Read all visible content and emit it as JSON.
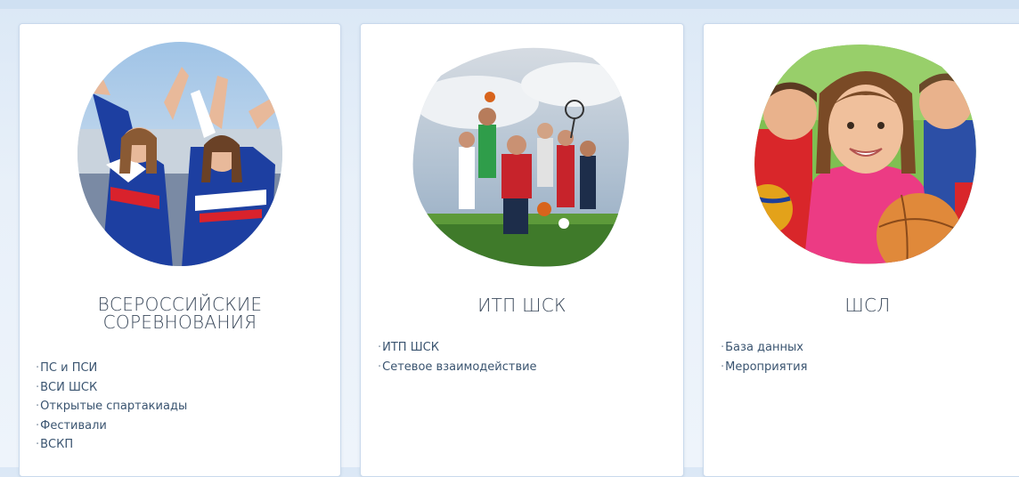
{
  "cards": [
    {
      "title_line1": "ВСЕРОССИЙСКИЕ",
      "title_line2": "СОРЕВНОВАНИЯ",
      "links": [
        "ПС и ПСИ",
        "ВСИ ШСК",
        "Открытые спартакиады",
        "Фестивали",
        "ВСКП"
      ]
    },
    {
      "title_line1": "ИТП ШСК",
      "links": [
        "ИТП ШСК",
        "Сетевое взаимодействие"
      ]
    },
    {
      "title_line1": "ШСЛ",
      "links": [
        "База данных",
        "Мероприятия"
      ]
    }
  ],
  "bullet": "·"
}
